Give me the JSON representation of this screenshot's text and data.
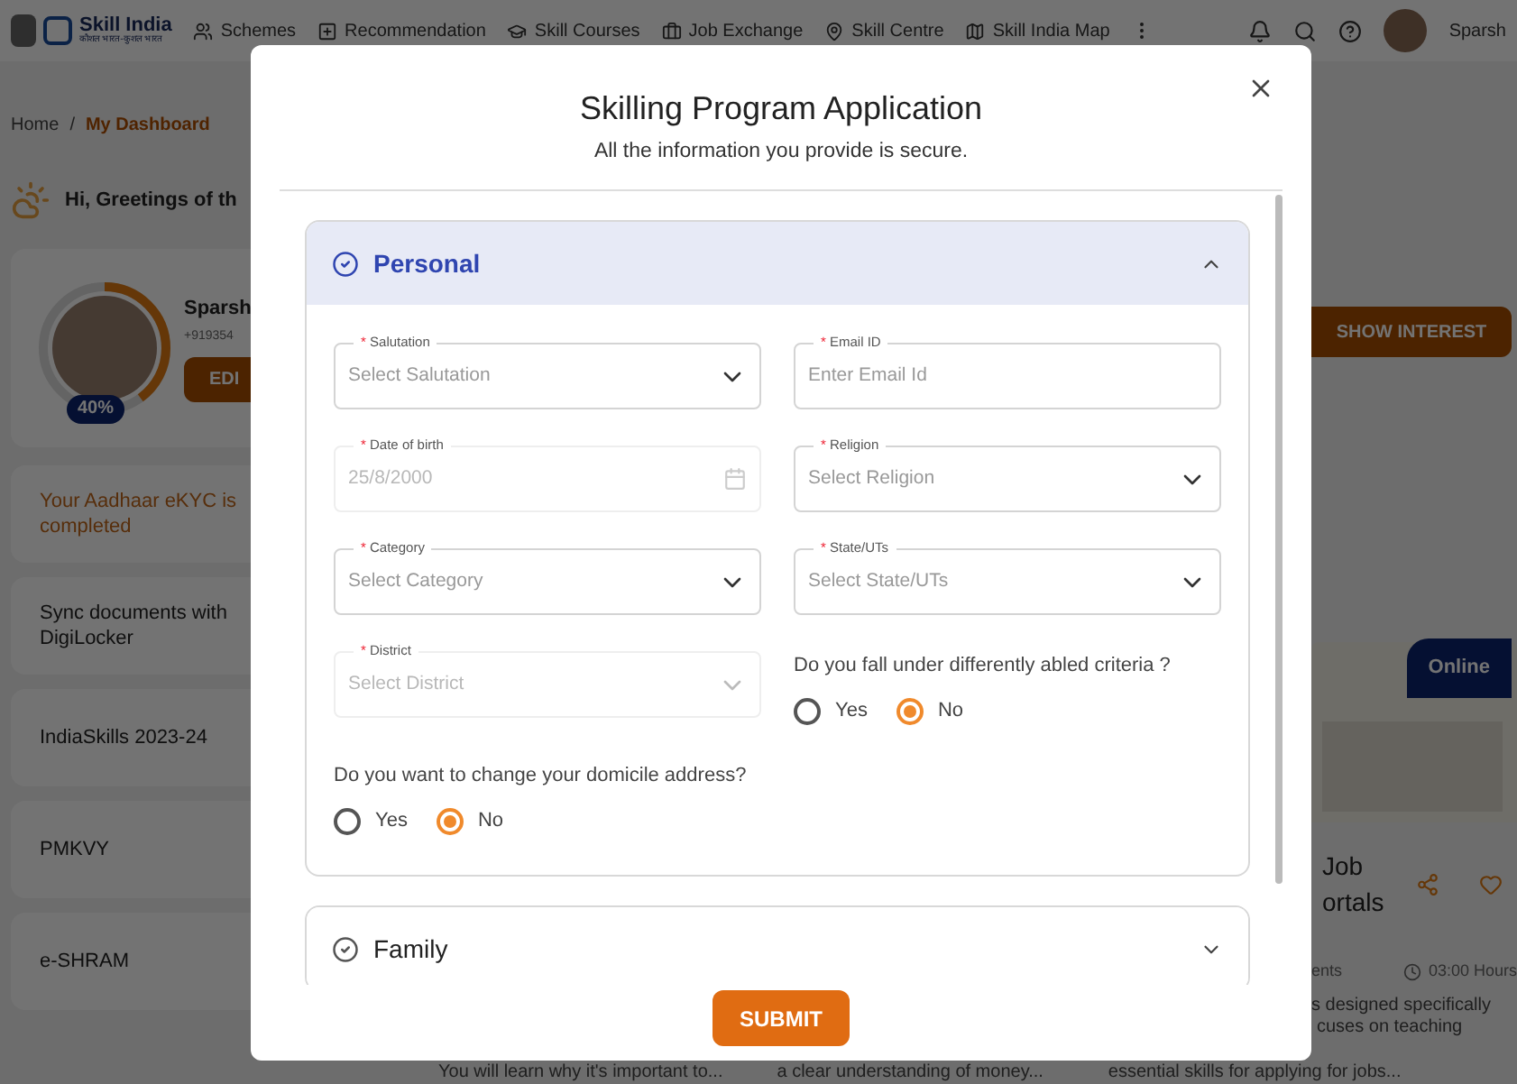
{
  "nav": {
    "logo_text": "Skill India",
    "logo_subtext": "कौशल भारत-कुशल भारत",
    "items": [
      "Schemes",
      "Recommendation",
      "Skill Courses",
      "Job Exchange",
      "Skill Centre",
      "Skill India Map"
    ],
    "user": "Sparsh"
  },
  "breadcrumb": [
    {
      "label": "Home",
      "selected": false
    },
    {
      "separator": "/",
      "label": "My Dashboard",
      "selected": true
    }
  ],
  "greeting": "Hi, Greetings of th",
  "profile": {
    "name": "Sparsh",
    "phone": "+919354",
    "edit": "EDI",
    "completion": "40%",
    "level": 0.4
  },
  "side_items": [
    {
      "label": "Your Aadhaar eKYC is",
      "line_2": "completed",
      "kind": "alert"
    },
    {
      "label": "Sync documents with",
      "line_2": "DigiLocker",
      "kind": "plain"
    },
    {
      "label": "IndiaSkills 2023-24",
      "kind": "plain"
    },
    {
      "label": "PMKVY",
      "kind": "plain"
    },
    {
      "label": "e-SHRAM",
      "kind": "plain"
    }
  ],
  "course_card": {
    "button": "SHOW INTEREST",
    "badge": "Online",
    "title_1": "Job",
    "title_2": "ortals",
    "meta": "ents",
    "duration": "03:00 Hours",
    "desc_1": "s designed specifically",
    "desc_2": "cuses on teaching"
  },
  "bottom_texts": [
    "You will learn why it's important to...",
    "a clear understanding of money...",
    "essential skills for applying for jobs..."
  ],
  "modal": {
    "title": "Skilling Program Application",
    "subtitle": "All the information you provide is secure.",
    "sections": [
      {
        "title": "Personal",
        "expanded": true,
        "fields": [
          {
            "kind": "select",
            "label": "Salutation",
            "placeholder": "Select Salutation",
            "disabled": false
          },
          {
            "kind": "input",
            "label": "Email ID",
            "placeholder": "Enter Email Id",
            "disabled": false
          },
          {
            "kind": "date",
            "label": "Date of birth",
            "value": "25/8/2000",
            "disabled": true
          },
          {
            "kind": "select",
            "label": "Religion",
            "placeholder": "Select Religion",
            "disabled": false
          },
          {
            "kind": "select",
            "label": "Category",
            "placeholder": "Select Category",
            "disabled": false
          },
          {
            "kind": "select",
            "label": "State/UTs",
            "placeholder": "Select State/UTs",
            "disabled": false
          },
          {
            "kind": "select",
            "label": "District",
            "placeholder": "Select District",
            "disabled": true
          },
          {
            "kind": "radio",
            "label": "Do you fall under differently abled criteria ?",
            "options": [
              {
                "label": "Yes",
                "selected": false
              },
              {
                "label": "No",
                "selected": true
              }
            ]
          },
          {
            "kind": "radio",
            "label": "Do you want to change your domicile address?",
            "options": [
              {
                "label": "Yes",
                "selected": false
              },
              {
                "label": "No",
                "selected": true
              }
            ]
          }
        ]
      },
      {
        "title": "Family",
        "expanded": false
      }
    ],
    "required_mark": "*",
    "submit": "SUBMIT"
  }
}
